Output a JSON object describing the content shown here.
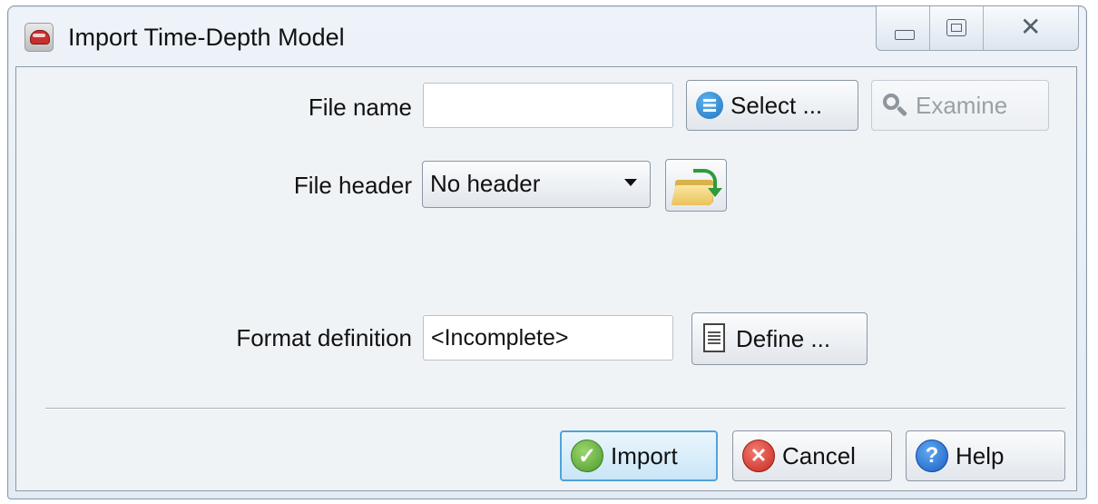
{
  "window": {
    "title": "Import Time-Depth Model",
    "controls": {
      "minimize": "minimize",
      "maximize": "maximize",
      "close": "close"
    }
  },
  "form": {
    "file_name_label": "File name",
    "file_name_value": "",
    "select_button": "Select ...",
    "examine_button": "Examine",
    "file_header_label": "File header",
    "file_header_value": "No header",
    "format_definition_label": "Format definition",
    "format_definition_value": "<Incomplete>",
    "define_button": "Define ..."
  },
  "footer": {
    "import_button": "Import",
    "cancel_button": "Cancel",
    "help_button": "Help"
  },
  "icons": {
    "app": "app-icon",
    "select": "list-icon",
    "examine": "magnifier-icon",
    "header_load": "folder-arrow-icon",
    "define": "document-icon",
    "import": "checkmark-icon",
    "cancel": "x-icon",
    "help": "question-icon"
  }
}
